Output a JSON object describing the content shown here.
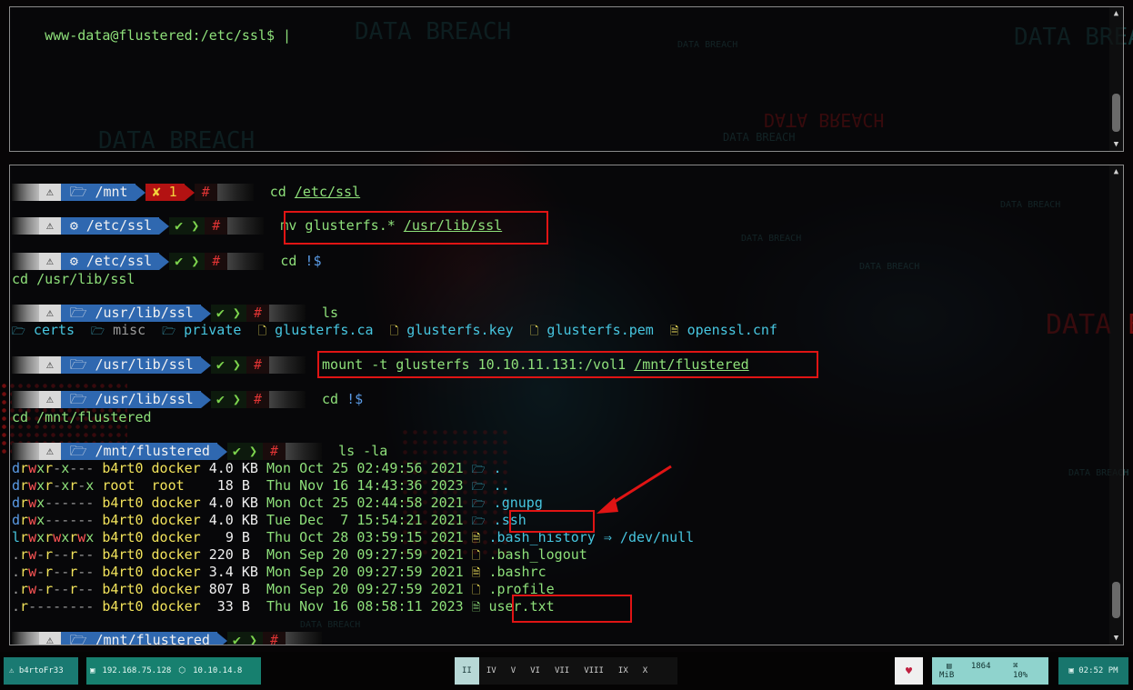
{
  "top_pane": {
    "prompt": "www-data@flustered:/etc/ssl$",
    "cursor": "|"
  },
  "prompt": {
    "os_glyph": "⚠",
    "ok_glyph": "✔",
    "err_glyph": "✘",
    "hash": "#"
  },
  "blocks": [
    {
      "dir_icon": "🗁",
      "dir": "/mnt",
      "status": "error",
      "err_code": "1",
      "cmd": "cd",
      "arg": "/etc/ssl"
    },
    {
      "dir_icon": "⚙",
      "dir": "/etc/ssl",
      "status": "ok",
      "cmd": "mv glusterfs.*",
      "arg": "/usr/lib/ssl"
    },
    {
      "dir_icon": "⚙",
      "dir": "/etc/ssl",
      "status": "ok",
      "cmd": "cd",
      "arg": "!$",
      "echo": "cd /usr/lib/ssl"
    },
    {
      "dir_icon": "🗁",
      "dir": "/usr/lib/ssl",
      "status": "ok",
      "cmd": "ls",
      "arg": ""
    },
    {
      "dir_icon": "🗁",
      "dir": "/usr/lib/ssl",
      "status": "ok",
      "cmd": "mount -t glusterfs 10.10.11.131:/vol1",
      "arg": "/mnt/flustered"
    },
    {
      "dir_icon": "🗁",
      "dir": "/usr/lib/ssl",
      "status": "ok",
      "cmd": "cd",
      "arg": "!$",
      "echo": "cd /mnt/flustered"
    },
    {
      "dir_icon": "🗁",
      "dir": "/mnt/flustered",
      "status": "ok",
      "cmd": "ls -la",
      "arg": ""
    },
    {
      "dir_icon": "🗁",
      "dir": "/mnt/flustered",
      "status": "ok",
      "cmd": "",
      "arg": ""
    }
  ],
  "ls_output": [
    {
      "icon": "🗁",
      "name": "certs"
    },
    {
      "icon": "🗁",
      "name": "misc"
    },
    {
      "icon": "🗁",
      "name": "private"
    },
    {
      "icon": "🗋",
      "name": "glusterfs.ca"
    },
    {
      "icon": "🗋",
      "name": "glusterfs.key"
    },
    {
      "icon": "🗋",
      "name": "glusterfs.pem"
    },
    {
      "icon": "🗎",
      "name": "openssl.cnf"
    }
  ],
  "ls_la": [
    {
      "type": "d",
      "perm": "rwxr-x---",
      "user": "b4rt0",
      "group": "docker",
      "size": "4.0",
      "unit": "KB",
      "dow": "Mon",
      "mon": "Oct",
      "day": "25",
      "time": "02:49:56",
      "year": "2021",
      "icon": "🗁",
      "name": "."
    },
    {
      "type": "d",
      "perm": "rwxr-xr-x",
      "user": "root",
      "group": "root",
      "size": "18",
      "unit": "B",
      "dow": "Thu",
      "mon": "Nov",
      "day": "16",
      "time": "14:43:36",
      "year": "2023",
      "icon": "🗁",
      "name": ".."
    },
    {
      "type": "d",
      "perm": "rwx------",
      "user": "b4rt0",
      "group": "docker",
      "size": "4.0",
      "unit": "KB",
      "dow": "Mon",
      "mon": "Oct",
      "day": "25",
      "time": "02:44:58",
      "year": "2021",
      "icon": "🗁",
      "name": ".gnupg"
    },
    {
      "type": "d",
      "perm": "rwx------",
      "user": "b4rt0",
      "group": "docker",
      "size": "4.0",
      "unit": "KB",
      "dow": "Tue",
      "mon": "Dec",
      "day": "7",
      "time": "15:54:21",
      "year": "2021",
      "icon": "🗁",
      "name": ".ssh"
    },
    {
      "type": "l",
      "perm": "rwxrwxrwx",
      "user": "b4rt0",
      "group": "docker",
      "size": "9",
      "unit": "B",
      "dow": "Thu",
      "mon": "Oct",
      "day": "28",
      "time": "03:59:15",
      "year": "2021",
      "icon": "🗎",
      "name": ".bash_history ⇒ /dev/null"
    },
    {
      "type": ".",
      "perm": "rw-r--r--",
      "user": "b4rt0",
      "group": "docker",
      "size": "220",
      "unit": "B",
      "dow": "Mon",
      "mon": "Sep",
      "day": "20",
      "time": "09:27:59",
      "year": "2021",
      "icon": "🗋",
      "name": ".bash_logout"
    },
    {
      "type": ".",
      "perm": "rw-r--r--",
      "user": "b4rt0",
      "group": "docker",
      "size": "3.4",
      "unit": "KB",
      "dow": "Mon",
      "mon": "Sep",
      "day": "20",
      "time": "09:27:59",
      "year": "2021",
      "icon": "🗎",
      "name": ".bashrc"
    },
    {
      "type": ".",
      "perm": "rw-r--r--",
      "user": "b4rt0",
      "group": "docker",
      "size": "807",
      "unit": "B",
      "dow": "Mon",
      "mon": "Sep",
      "day": "20",
      "time": "09:27:59",
      "year": "2021",
      "icon": "🗋",
      "name": ".profile"
    },
    {
      "type": ".",
      "perm": "r--------",
      "user": "b4rt0",
      "group": "docker",
      "size": "33",
      "unit": "B",
      "dow": "Thu",
      "mon": "Nov",
      "day": "16",
      "time": "08:58:11",
      "year": "2023",
      "icon": "🗎",
      "name": "user.txt"
    }
  ],
  "background_text": {
    "large": "DATA BREACH",
    "small": "DATA BREACH"
  },
  "taskbar": {
    "user_icon": "⚠",
    "user": "b4rtoFr33",
    "ip1_icon": "▣",
    "ip1": "192.168.75.128",
    "ip2_icon": "⬡",
    "ip2": "10.10.14.8",
    "workspaces": [
      "II",
      "IV",
      "V",
      "VI",
      "VII",
      "VIII",
      "IX",
      "X"
    ],
    "active_workspace": "II",
    "heart": "♥",
    "mem_icon": "▤",
    "mem": "1864 MiB",
    "cpu_icon": "⌘",
    "cpu": "10%",
    "clock_icon": "▣",
    "clock": "02:52 PM"
  },
  "colors": {
    "prompt_dir_bg": "#2f68b0",
    "error_bg": "#b31212",
    "highlight": "#e01414",
    "taskbar_teal": "#18766d"
  }
}
